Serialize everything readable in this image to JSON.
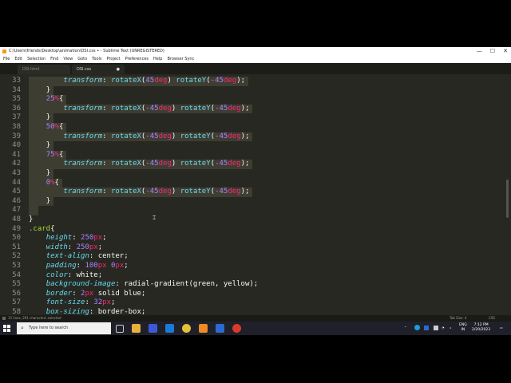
{
  "window": {
    "title": "C:\\Users\\friends\\Desktop\\animation\\DSI.css • - Sublime Text (UNREGISTERED)",
    "minimize": "—",
    "maximize": "☐",
    "close": "✕"
  },
  "menu": [
    "File",
    "Edit",
    "Selection",
    "Find",
    "View",
    "Goto",
    "Tools",
    "Project",
    "Preferences",
    "Help",
    "Browser Sync"
  ],
  "tabs": [
    {
      "label": "DSI.html",
      "active": false
    },
    {
      "label": "DSI.css",
      "active": true,
      "close": "●"
    }
  ],
  "lines": [
    {
      "num": "33",
      "sel": true,
      "tokens": [
        [
          "i",
          "        "
        ],
        [
          "pr",
          "transform"
        ],
        [
          "p",
          ": "
        ],
        [
          "fn",
          "rotateX"
        ],
        [
          "p",
          "("
        ],
        [
          "num",
          "45"
        ],
        [
          "unit",
          "deg"
        ],
        [
          "p",
          ") "
        ],
        [
          "fn",
          "rotateY"
        ],
        [
          "p",
          "("
        ],
        [
          "num",
          "-45"
        ],
        [
          "unit",
          "deg"
        ],
        [
          "p",
          ");"
        ]
      ]
    },
    {
      "num": "34",
      "sel": true,
      "tokens": [
        [
          "i",
          "    "
        ],
        [
          "p",
          "}"
        ]
      ]
    },
    {
      "num": "35",
      "sel": true,
      "tokens": [
        [
          "i",
          "    "
        ],
        [
          "num",
          "25"
        ],
        [
          "unit",
          "%"
        ],
        [
          "p",
          "{"
        ]
      ]
    },
    {
      "num": "36",
      "sel": true,
      "tokens": [
        [
          "i",
          "        "
        ],
        [
          "pr",
          "transform"
        ],
        [
          "p",
          ": "
        ],
        [
          "fn",
          "rotateX"
        ],
        [
          "p",
          "("
        ],
        [
          "num",
          "-45"
        ],
        [
          "unit",
          "deg"
        ],
        [
          "p",
          ") "
        ],
        [
          "fn",
          "rotateY"
        ],
        [
          "p",
          "("
        ],
        [
          "num",
          "-45"
        ],
        [
          "unit",
          "deg"
        ],
        [
          "p",
          ");"
        ]
      ]
    },
    {
      "num": "37",
      "sel": true,
      "tokens": [
        [
          "i",
          "    "
        ],
        [
          "p",
          "}"
        ]
      ]
    },
    {
      "num": "38",
      "sel": true,
      "tokens": [
        [
          "i",
          "    "
        ],
        [
          "num",
          "50"
        ],
        [
          "unit",
          "%"
        ],
        [
          "p",
          "{"
        ]
      ]
    },
    {
      "num": "39",
      "sel": true,
      "tokens": [
        [
          "i",
          "        "
        ],
        [
          "pr",
          "transform"
        ],
        [
          "p",
          ": "
        ],
        [
          "fn",
          "rotateX"
        ],
        [
          "p",
          "("
        ],
        [
          "num",
          "-45"
        ],
        [
          "unit",
          "deg"
        ],
        [
          "p",
          ") "
        ],
        [
          "fn",
          "rotateY"
        ],
        [
          "p",
          "("
        ],
        [
          "num",
          "-45"
        ],
        [
          "unit",
          "deg"
        ],
        [
          "p",
          ");"
        ]
      ]
    },
    {
      "num": "40",
      "sel": true,
      "tokens": [
        [
          "i",
          "    "
        ],
        [
          "p",
          "}"
        ]
      ]
    },
    {
      "num": "41",
      "sel": true,
      "tokens": [
        [
          "i",
          "    "
        ],
        [
          "num",
          "75"
        ],
        [
          "unit",
          "%"
        ],
        [
          "p",
          "{"
        ]
      ]
    },
    {
      "num": "42",
      "sel": true,
      "tokens": [
        [
          "i",
          "        "
        ],
        [
          "pr",
          "transform"
        ],
        [
          "p",
          ": "
        ],
        [
          "fn",
          "rotateX"
        ],
        [
          "p",
          "("
        ],
        [
          "num",
          "-45"
        ],
        [
          "unit",
          "deg"
        ],
        [
          "p",
          ") "
        ],
        [
          "fn",
          "rotateY"
        ],
        [
          "p",
          "("
        ],
        [
          "num",
          "-45"
        ],
        [
          "unit",
          "deg"
        ],
        [
          "p",
          ");"
        ]
      ]
    },
    {
      "num": "43",
      "sel": true,
      "tokens": [
        [
          "i",
          "    "
        ],
        [
          "p",
          "}"
        ]
      ]
    },
    {
      "num": "44",
      "sel": true,
      "tokens": [
        [
          "i",
          "    "
        ],
        [
          "num",
          "0"
        ],
        [
          "unit",
          "%"
        ],
        [
          "p",
          "{"
        ]
      ]
    },
    {
      "num": "45",
      "sel": true,
      "tokens": [
        [
          "i",
          "        "
        ],
        [
          "pr",
          "transform"
        ],
        [
          "p",
          ": "
        ],
        [
          "fn",
          "rotateX"
        ],
        [
          "p",
          "("
        ],
        [
          "num",
          "-45"
        ],
        [
          "unit",
          "deg"
        ],
        [
          "p",
          ") "
        ],
        [
          "fn",
          "rotateY"
        ],
        [
          "p",
          "("
        ],
        [
          "num",
          "-45"
        ],
        [
          "unit",
          "deg"
        ],
        [
          "p",
          ");"
        ]
      ]
    },
    {
      "num": "46",
      "sel": true,
      "tokens": [
        [
          "i",
          "    "
        ],
        [
          "p",
          "}"
        ]
      ]
    },
    {
      "num": "47",
      "sel": true,
      "tokens": []
    },
    {
      "num": "48",
      "sel": false,
      "tokens": [
        [
          "p",
          "}"
        ]
      ]
    },
    {
      "num": "49",
      "sel": false,
      "tokens": [
        [
          "sk",
          ".card"
        ],
        [
          "p",
          "{"
        ]
      ]
    },
    {
      "num": "50",
      "sel": false,
      "tokens": [
        [
          "i",
          "    "
        ],
        [
          "pr",
          "height"
        ],
        [
          "p",
          ": "
        ],
        [
          "num",
          "250"
        ],
        [
          "unit",
          "px"
        ],
        [
          "p",
          ";"
        ]
      ]
    },
    {
      "num": "51",
      "sel": false,
      "tokens": [
        [
          "i",
          "    "
        ],
        [
          "pr",
          "width"
        ],
        [
          "p",
          ": "
        ],
        [
          "num",
          "250"
        ],
        [
          "unit",
          "px"
        ],
        [
          "p",
          ";"
        ]
      ]
    },
    {
      "num": "52",
      "sel": false,
      "tokens": [
        [
          "i",
          "    "
        ],
        [
          "pr",
          "text-align"
        ],
        [
          "p",
          ": center;"
        ]
      ]
    },
    {
      "num": "53",
      "sel": false,
      "tokens": [
        [
          "i",
          "    "
        ],
        [
          "pr",
          "padding"
        ],
        [
          "p",
          ": "
        ],
        [
          "num",
          "100"
        ],
        [
          "unit",
          "px"
        ],
        [
          "p",
          " "
        ],
        [
          "num",
          "0"
        ],
        [
          "unit",
          "px"
        ],
        [
          "p",
          ";"
        ]
      ]
    },
    {
      "num": "54",
      "sel": false,
      "tokens": [
        [
          "i",
          "    "
        ],
        [
          "pr",
          "color"
        ],
        [
          "p",
          ": white;"
        ]
      ]
    },
    {
      "num": "55",
      "sel": false,
      "tokens": [
        [
          "i",
          "    "
        ],
        [
          "pr",
          "background-image"
        ],
        [
          "p",
          ": radial-gradient(green, yellow);"
        ]
      ]
    },
    {
      "num": "56",
      "sel": false,
      "tokens": [
        [
          "i",
          "    "
        ],
        [
          "pr",
          "border"
        ],
        [
          "p",
          ": "
        ],
        [
          "num",
          "2"
        ],
        [
          "unit",
          "px"
        ],
        [
          "p",
          " solid blue;"
        ]
      ]
    },
    {
      "num": "57",
      "sel": false,
      "tokens": [
        [
          "i",
          "    "
        ],
        [
          "pr",
          "font-size"
        ],
        [
          "p",
          ": "
        ],
        [
          "num",
          "32"
        ],
        [
          "unit",
          "px"
        ],
        [
          "p",
          ";"
        ]
      ]
    },
    {
      "num": "58",
      "sel": false,
      "tokens": [
        [
          "i",
          "    "
        ],
        [
          "pr",
          "box-sizing"
        ],
        [
          "p",
          ": border-box;"
        ]
      ]
    }
  ],
  "status": {
    "left": "15 lines, 291 characters selected",
    "tab_size": "Tab Size: 4",
    "syntax": "CSS"
  },
  "taskbar": {
    "search_placeholder": "Type here to search",
    "lang_top": "ENG",
    "lang_bottom": "IN",
    "time": "7:12 PM",
    "date": "2/20/2023"
  },
  "colors": {
    "editor_bg": "#272822",
    "selection": "#3e3d32",
    "property": "#66d9ef",
    "number": "#ae81ff",
    "unit": "#f92672",
    "selector": "#a6e22e"
  }
}
